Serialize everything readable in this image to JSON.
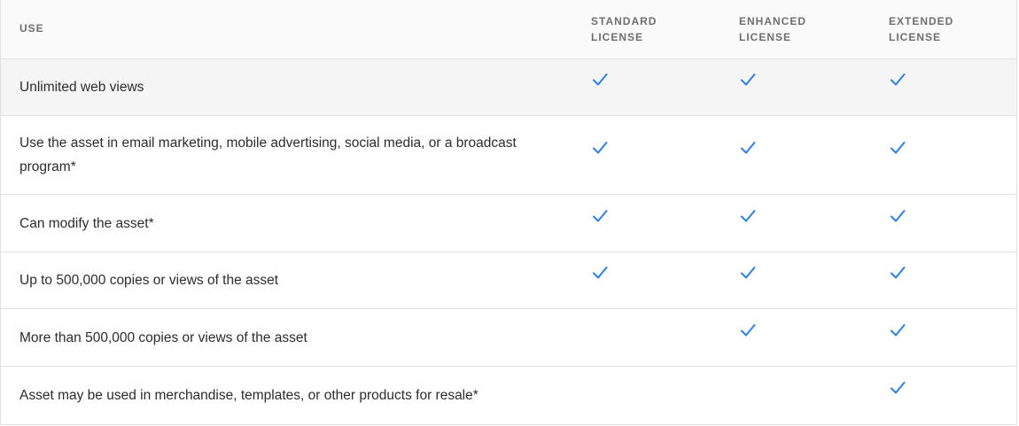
{
  "header": {
    "use": "USE",
    "columns": [
      {
        "line1": "STANDARD",
        "line2": "LICENSE"
      },
      {
        "line1": "ENHANCED",
        "line2": "LICENSE"
      },
      {
        "line1": "EXTENDED",
        "line2": "LICENSE"
      }
    ]
  },
  "rows": [
    {
      "label": "Unlimited web views",
      "checks": [
        true,
        true,
        true
      ]
    },
    {
      "label": "Use the asset in email marketing, mobile advertising, social media, or a broadcast program*",
      "checks": [
        true,
        true,
        true
      ]
    },
    {
      "label": "Can modify the asset*",
      "checks": [
        true,
        true,
        true
      ]
    },
    {
      "label": "Up to 500,000 copies or views of the asset",
      "checks": [
        true,
        true,
        true
      ]
    },
    {
      "label": "More than 500,000 copies or views of the asset",
      "checks": [
        false,
        true,
        true
      ]
    },
    {
      "label": "Asset may be used in merchandise, templates, or other products for resale*",
      "checks": [
        false,
        false,
        true
      ]
    }
  ],
  "icons": {
    "check": "checkmark-icon"
  },
  "colors": {
    "check": "#2d7fe0",
    "border": "#e1e1e1",
    "header_text": "#6e6e6e"
  }
}
